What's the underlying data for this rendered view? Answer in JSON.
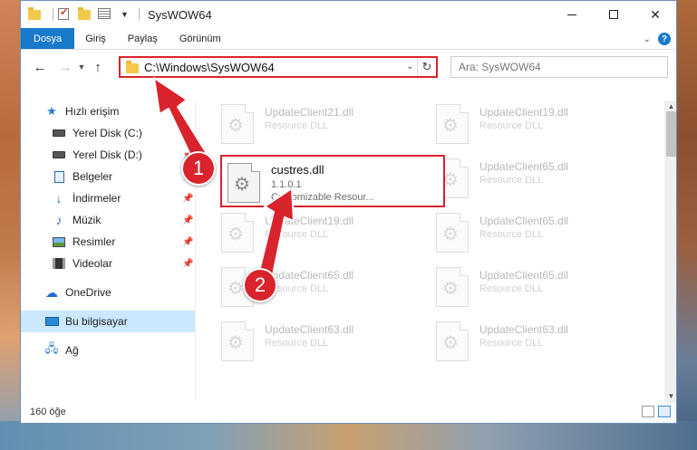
{
  "window": {
    "title": "SysWOW64",
    "minimize": "—",
    "maximize": "",
    "close": "✕"
  },
  "ribbon": {
    "tabs": [
      "Dosya",
      "Giriş",
      "Paylaş",
      "Görünüm"
    ],
    "help": "?"
  },
  "nav": {
    "address": "C:\\Windows\\SysWOW64",
    "search_placeholder": "Ara: SysWOW64"
  },
  "sidebar": {
    "quick_access": "Hızlı erişim",
    "items": [
      {
        "label": "Yerel Disk (C:)",
        "pinned": true
      },
      {
        "label": "Yerel Disk (D:)",
        "pinned": true
      },
      {
        "label": "Belgeler",
        "pinned": true
      },
      {
        "label": "İndirmeler",
        "pinned": true
      },
      {
        "label": "Müzik",
        "pinned": true
      },
      {
        "label": "Resimler",
        "pinned": true
      },
      {
        "label": "Videolar",
        "pinned": true
      }
    ],
    "onedrive": "OneDrive",
    "this_pc": "Bu bilgisayar",
    "network": "Ağ"
  },
  "files": {
    "highlighted": {
      "name": "custres.dll",
      "version": "1.1.0.1",
      "description": "Customizable Resour..."
    },
    "background": [
      {
        "name": "UpdateClient21.dll",
        "desc": "Resource DLL"
      },
      {
        "name": "UpdateClient19.dll",
        "desc": "Resource DLL"
      },
      {
        "name": "UpdateClient65.dll",
        "desc": "Resource DLL"
      },
      {
        "name": "UpdateClient19.dll",
        "desc": "Resource DLL"
      },
      {
        "name": "UpdateClient65.dll",
        "desc": "Resource DLL"
      },
      {
        "name": "UpdateClient65.dll",
        "desc": "Resource DLL"
      },
      {
        "name": "UpdateClient65.dll",
        "desc": "Resource DLL"
      },
      {
        "name": "UpdateClient63.dll",
        "desc": "Resource DLL"
      },
      {
        "name": "UpdateClient63.dll",
        "desc": "Resource DLL"
      }
    ]
  },
  "status": {
    "count": "160 öğe"
  },
  "callouts": {
    "one": "1",
    "two": "2"
  },
  "colors": {
    "accent": "#1979ca",
    "highlight": "#d9232d",
    "selection": "#cce8ff"
  }
}
